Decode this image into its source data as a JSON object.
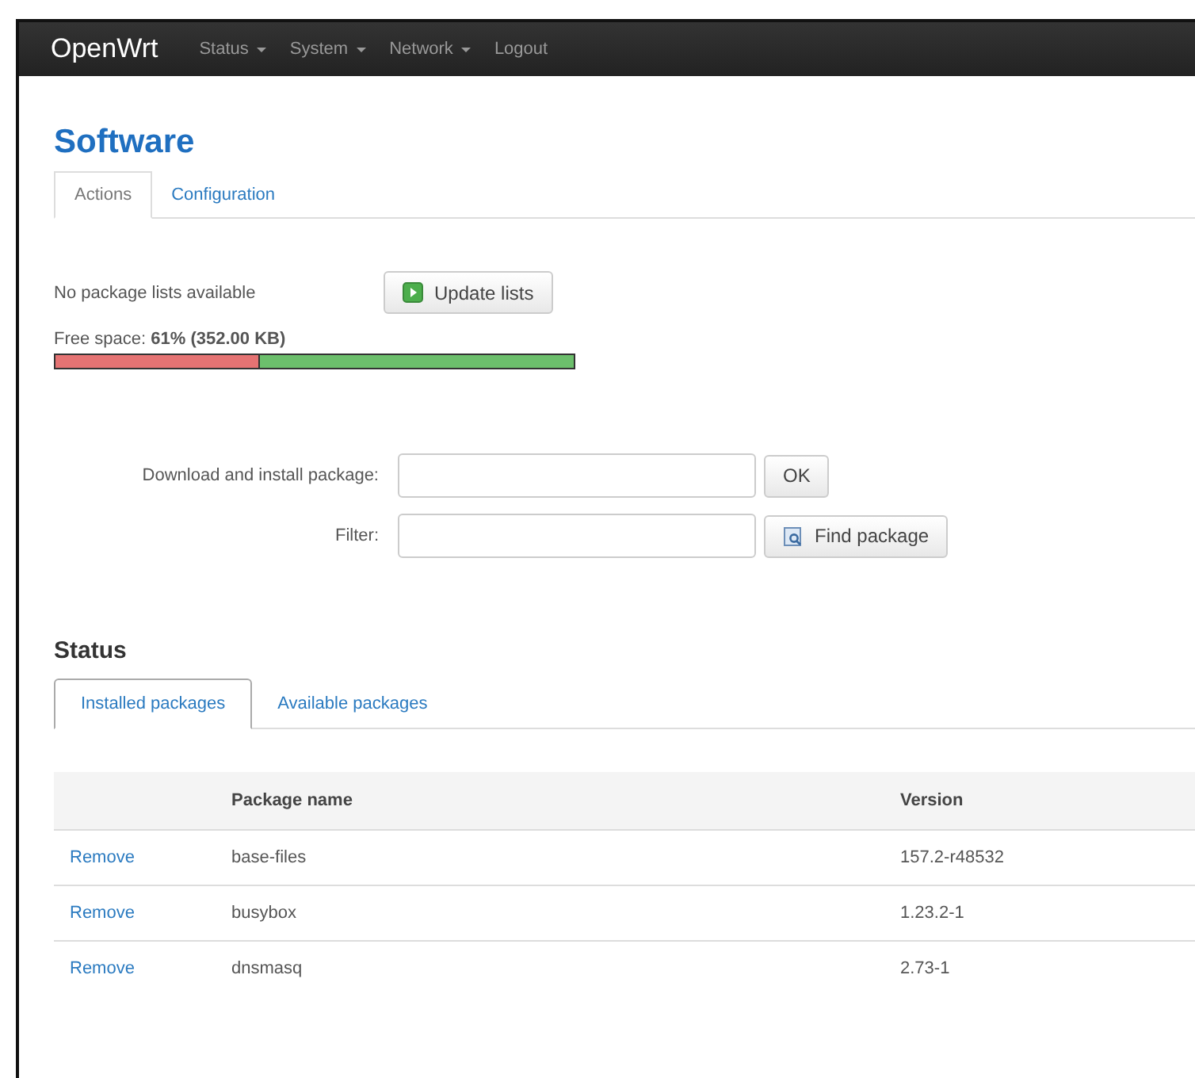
{
  "navbar": {
    "brand": "OpenWrt",
    "menu": [
      {
        "label": "Status",
        "dropdown": true
      },
      {
        "label": "System",
        "dropdown": true
      },
      {
        "label": "Network",
        "dropdown": true
      },
      {
        "label": "Logout",
        "dropdown": false
      }
    ]
  },
  "page_title": "Software",
  "tabs": [
    {
      "label": "Actions",
      "selected": true
    },
    {
      "label": "Configuration",
      "selected": false
    }
  ],
  "lists": {
    "message": "No package lists available",
    "button": "Update lists"
  },
  "free_space": {
    "label": "Free space:",
    "value": "61% (352.00 KB)",
    "level": 0.61
  },
  "install": {
    "label": "Download and install package:",
    "button": "OK"
  },
  "filter": {
    "label": "Filter:",
    "button": "Find package"
  },
  "status": {
    "title": "Status",
    "tabs": [
      {
        "label": "Installed packages",
        "selected": true
      },
      {
        "label": "Available packages",
        "selected": false
      }
    ],
    "columns": [
      "Package name",
      "Version"
    ],
    "rows": [
      {
        "action": "Remove",
        "name": "base-files",
        "version": "157.2-r48532"
      },
      {
        "action": "Remove",
        "name": "busybox",
        "version": "1.23.2-1"
      },
      {
        "action": "Remove",
        "name": "dnsmasq",
        "version": "2.73-1"
      }
    ]
  }
}
